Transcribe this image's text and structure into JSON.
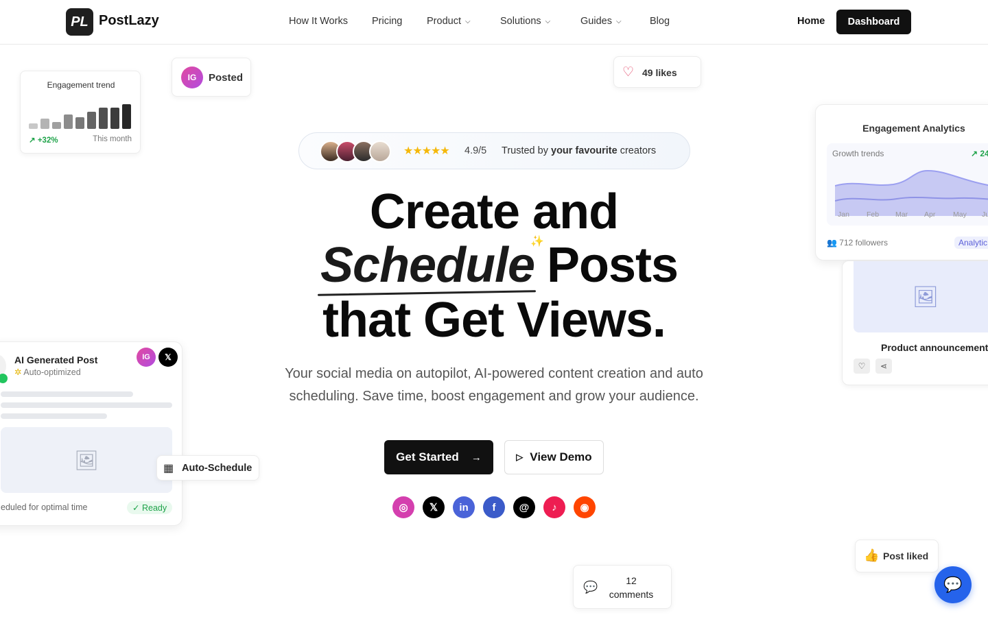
{
  "nav": {
    "brand_mark": "PL",
    "brand": "PostLazy",
    "links": [
      "How It Works",
      "Pricing",
      "Product",
      "Solutions",
      "Guides",
      "Blog"
    ],
    "home": "Home",
    "dashboard": "Dashboard"
  },
  "engagement_trend": {
    "title": "Engagement trend",
    "change": "+32%",
    "period": "This month",
    "bars": [
      0.2,
      0.35,
      0.25,
      0.5,
      0.4,
      0.6,
      0.75,
      0.75,
      0.85
    ]
  },
  "posted": {
    "badge": "IG",
    "label": "Posted"
  },
  "likes": {
    "label": "49 likes"
  },
  "trust": {
    "stars": "★★★★★",
    "rating": "4.9/5",
    "text_pre": "Trusted by",
    "text_bold": "your favourite",
    "text_post": "creators"
  },
  "hero": {
    "line1": "Create and",
    "line2_em": "Schedule",
    "line2_rest": "Posts",
    "line3": "that Get Views.",
    "sparkle": "✨"
  },
  "subtitle": "Your social media on autopilot, AI-powered content creation and auto scheduling. Save time, boost engagement and grow your audience.",
  "cta": {
    "start": "Get Started",
    "demo": "View Demo"
  },
  "socials": [
    {
      "name": "instagram",
      "glyph": "◎",
      "color": "#d43fae"
    },
    {
      "name": "x",
      "glyph": "𝕏",
      "color": "#000000"
    },
    {
      "name": "linkedin",
      "glyph": "in",
      "color": "#4a63d8"
    },
    {
      "name": "facebook",
      "glyph": "f",
      "color": "#3b5bc9"
    },
    {
      "name": "threads",
      "glyph": "@",
      "color": "#000000"
    },
    {
      "name": "tiktok",
      "glyph": "♪",
      "color": "#ee1d52"
    },
    {
      "name": "reddit",
      "glyph": "◉",
      "color": "#ff4500"
    }
  ],
  "analytics": {
    "title": "Engagement Analytics",
    "growth": "Growth trends",
    "growth_value": "24",
    "months": [
      "Jan",
      "Feb",
      "Mar",
      "Apr",
      "May",
      "Ju"
    ],
    "followers": "712 followers",
    "tag": "Analytic"
  },
  "product": {
    "title": "Product announcement"
  },
  "ai_post": {
    "title": "AI Generated Post",
    "subtitle": "Auto-optimized",
    "badge_ig": "IG",
    "badge_x": "𝕏",
    "footer": "eduled for optimal time",
    "status": "Ready"
  },
  "auto_schedule": {
    "label": "Auto-Schedule"
  },
  "post_liked": {
    "label": "Post liked"
  },
  "comments": {
    "line1": "12",
    "line2": "comments"
  }
}
